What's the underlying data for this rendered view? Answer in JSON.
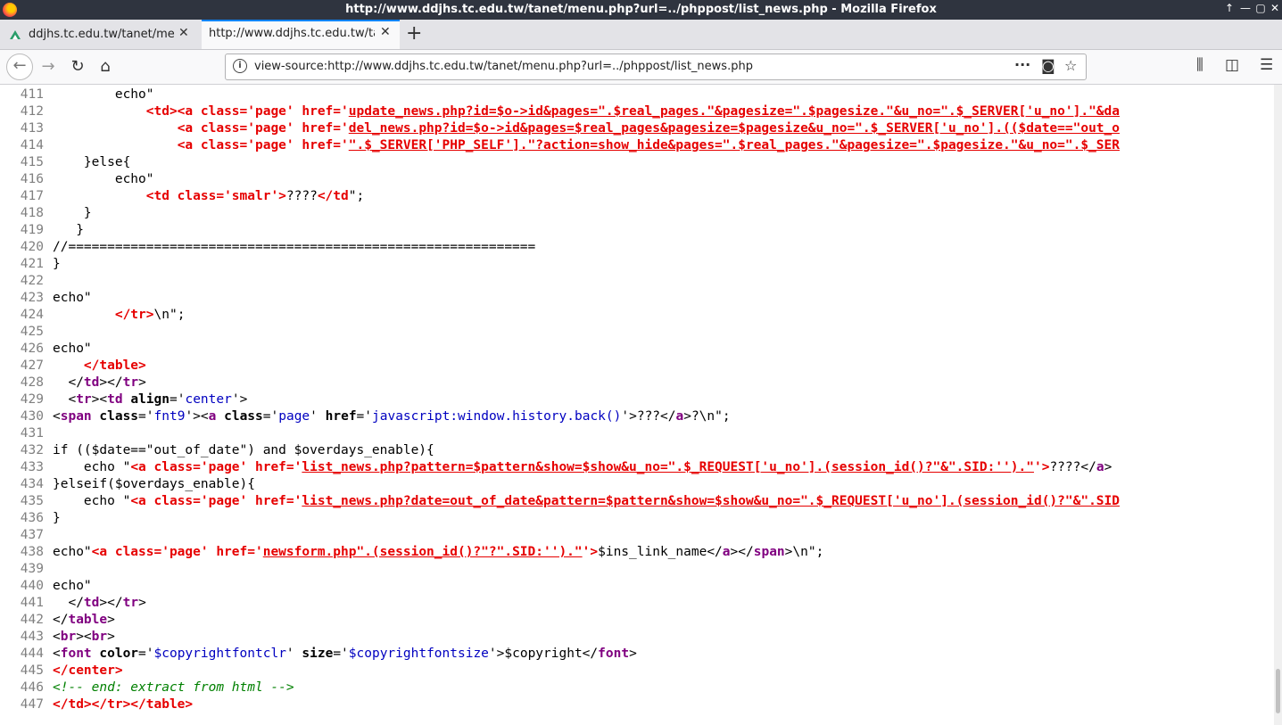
{
  "window": {
    "title": "http://www.ddjhs.tc.edu.tw/tanet/menu.php?url=../phppost/list_news.php - Mozilla Firefox",
    "controls": [
      "↑",
      "—",
      "▢",
      "✕"
    ]
  },
  "tabs": [
    {
      "label": "ddjhs.tc.edu.tw/tanet/me"
    },
    {
      "label": "http://www.ddjhs.tc.edu.tw/ta"
    }
  ],
  "toolbar": {
    "url": "view-source:http://www.ddjhs.tc.edu.tw/tanet/menu.php?url=../phppost/list_news.php",
    "more": "···"
  },
  "source_lines": [
    {
      "n": "411",
      "segs": [
        [
          "c",
          "        echo\""
        ]
      ]
    },
    {
      "n": "412",
      "segs": [
        [
          "c",
          "            "
        ],
        [
          "r",
          "<td><a class='page' href='"
        ],
        [
          "rl",
          "update_news.php?id=$o->id&pages=\".$real_pages.\"&pagesize=\".$pagesize.\"&u_no=\".$_SERVER['u_no'].\"&da"
        ]
      ]
    },
    {
      "n": "413",
      "segs": [
        [
          "c",
          "                "
        ],
        [
          "r",
          "<a class='page' href='"
        ],
        [
          "rl",
          "del_news.php?id=$o->id&pages=$real_pages&pagesize=$pagesize&u_no=\".$_SERVER['u_no'].(($date==\"out_o"
        ]
      ]
    },
    {
      "n": "414",
      "segs": [
        [
          "c",
          "                "
        ],
        [
          "r",
          "<a class='page' href='"
        ],
        [
          "rl",
          "\".$_SERVER['PHP_SELF'].\"?action=show_hide&pages=\".$real_pages.\"&pagesize=\".$pagesize.\"&u_no=\".$_SER"
        ]
      ]
    },
    {
      "n": "415",
      "segs": [
        [
          "c",
          "    }else{"
        ]
      ]
    },
    {
      "n": "416",
      "segs": [
        [
          "c",
          "        echo\""
        ]
      ]
    },
    {
      "n": "417",
      "segs": [
        [
          "c",
          "            "
        ],
        [
          "r",
          "<td class='smalr'>"
        ],
        [
          "c",
          "????"
        ],
        [
          "r",
          "</td"
        ],
        [
          "c",
          "\";"
        ]
      ]
    },
    {
      "n": "418",
      "segs": [
        [
          "c",
          "    }"
        ]
      ]
    },
    {
      "n": "419",
      "segs": [
        [
          "c",
          "   }"
        ]
      ]
    },
    {
      "n": "420",
      "segs": [
        [
          "c",
          "//============================================================"
        ]
      ]
    },
    {
      "n": "421",
      "segs": [
        [
          "c",
          "}"
        ]
      ]
    },
    {
      "n": "422",
      "segs": [
        [
          "c",
          ""
        ]
      ]
    },
    {
      "n": "423",
      "segs": [
        [
          "c",
          "echo\""
        ]
      ]
    },
    {
      "n": "424",
      "segs": [
        [
          "c",
          "        "
        ],
        [
          "r",
          "</tr>"
        ],
        [
          "c",
          "\\n\";"
        ]
      ]
    },
    {
      "n": "425",
      "segs": [
        [
          "c",
          ""
        ]
      ]
    },
    {
      "n": "426",
      "segs": [
        [
          "c",
          "echo\""
        ]
      ]
    },
    {
      "n": "427",
      "segs": [
        [
          "c",
          "    "
        ],
        [
          "r",
          "</table>"
        ]
      ]
    },
    {
      "n": "428",
      "segs": [
        [
          "c",
          "  </"
        ],
        [
          "t",
          "td"
        ],
        [
          "c",
          "></"
        ],
        [
          "t",
          "tr"
        ],
        [
          "c",
          ">"
        ]
      ]
    },
    {
      "n": "429",
      "segs": [
        [
          "c",
          "  <"
        ],
        [
          "t",
          "tr"
        ],
        [
          "c",
          "><"
        ],
        [
          "t",
          "td"
        ],
        [
          "c",
          " "
        ],
        [
          "b",
          "align"
        ],
        [
          "c",
          "='"
        ],
        [
          "v",
          "center"
        ],
        [
          "c",
          "'>"
        ]
      ]
    },
    {
      "n": "430",
      "segs": [
        [
          "c",
          "<"
        ],
        [
          "t",
          "span"
        ],
        [
          "c",
          " "
        ],
        [
          "b",
          "class"
        ],
        [
          "c",
          "='"
        ],
        [
          "v",
          "fnt9"
        ],
        [
          "c",
          "'><"
        ],
        [
          "t",
          "a"
        ],
        [
          "c",
          " "
        ],
        [
          "b",
          "class"
        ],
        [
          "c",
          "='"
        ],
        [
          "v",
          "page"
        ],
        [
          "c",
          "' "
        ],
        [
          "b",
          "href"
        ],
        [
          "c",
          "='"
        ],
        [
          "v",
          "javascript:window.history.back()"
        ],
        [
          "c",
          "'>???</"
        ],
        [
          "t",
          "a"
        ],
        [
          "c",
          ">?\\n\";"
        ]
      ]
    },
    {
      "n": "431",
      "segs": [
        [
          "c",
          ""
        ]
      ]
    },
    {
      "n": "432",
      "segs": [
        [
          "c",
          "if (($date==\"out_of_date\") and $overdays_enable){"
        ]
      ]
    },
    {
      "n": "433",
      "segs": [
        [
          "c",
          "    echo \""
        ],
        [
          "r",
          "<a class='page' href='"
        ],
        [
          "rl",
          "list_news.php?pattern=$pattern&show=$show&u_no=\".$_REQUEST['u_no'].(session_id()?\"&\".SID:'').\""
        ],
        [
          "r",
          "'>"
        ],
        [
          "c",
          "????</"
        ],
        [
          "t",
          "a"
        ],
        [
          "c",
          ">"
        ]
      ]
    },
    {
      "n": "434",
      "segs": [
        [
          "c",
          "}elseif($overdays_enable){"
        ]
      ]
    },
    {
      "n": "435",
      "segs": [
        [
          "c",
          "    echo \""
        ],
        [
          "r",
          "<a class='page' href='"
        ],
        [
          "rl",
          "list_news.php?date=out_of_date&pattern=$pattern&show=$show&u_no=\".$_REQUEST['u_no'].(session_id()?\"&\".SID"
        ]
      ]
    },
    {
      "n": "436",
      "segs": [
        [
          "c",
          "}"
        ]
      ]
    },
    {
      "n": "437",
      "segs": [
        [
          "c",
          ""
        ]
      ]
    },
    {
      "n": "438",
      "segs": [
        [
          "c",
          "echo\""
        ],
        [
          "r",
          "<a class='page' href='"
        ],
        [
          "rl",
          "newsform.php\".(session_id()?\"?\".SID:'').\""
        ],
        [
          "r",
          "'>"
        ],
        [
          "c",
          "$ins_link_name</"
        ],
        [
          "t",
          "a"
        ],
        [
          "c",
          "></"
        ],
        [
          "t",
          "span"
        ],
        [
          "c",
          ">\\n\";"
        ]
      ]
    },
    {
      "n": "439",
      "segs": [
        [
          "c",
          ""
        ]
      ]
    },
    {
      "n": "440",
      "segs": [
        [
          "c",
          "echo\""
        ]
      ]
    },
    {
      "n": "441",
      "segs": [
        [
          "c",
          "  </"
        ],
        [
          "t",
          "td"
        ],
        [
          "c",
          "></"
        ],
        [
          "t",
          "tr"
        ],
        [
          "c",
          ">"
        ]
      ]
    },
    {
      "n": "442",
      "segs": [
        [
          "c",
          "</"
        ],
        [
          "t",
          "table"
        ],
        [
          "c",
          ">"
        ]
      ]
    },
    {
      "n": "443",
      "segs": [
        [
          "c",
          "<"
        ],
        [
          "t",
          "br"
        ],
        [
          "c",
          "><"
        ],
        [
          "t",
          "br"
        ],
        [
          "c",
          ">"
        ]
      ]
    },
    {
      "n": "444",
      "segs": [
        [
          "c",
          "<"
        ],
        [
          "t",
          "font"
        ],
        [
          "c",
          " "
        ],
        [
          "b",
          "color"
        ],
        [
          "c",
          "='"
        ],
        [
          "v",
          "$copyrightfontclr"
        ],
        [
          "c",
          "' "
        ],
        [
          "b",
          "size"
        ],
        [
          "c",
          "='"
        ],
        [
          "v",
          "$copyrightfontsize"
        ],
        [
          "c",
          "'>$copyright</"
        ],
        [
          "t",
          "font"
        ],
        [
          "c",
          ">"
        ]
      ]
    },
    {
      "n": "445",
      "segs": [
        [
          "r",
          "</center>"
        ]
      ]
    },
    {
      "n": "446",
      "segs": [
        [
          "g",
          "<!-- end: extract from html -->"
        ]
      ]
    },
    {
      "n": "447",
      "segs": [
        [
          "r",
          "</td></tr></table>"
        ]
      ]
    }
  ]
}
